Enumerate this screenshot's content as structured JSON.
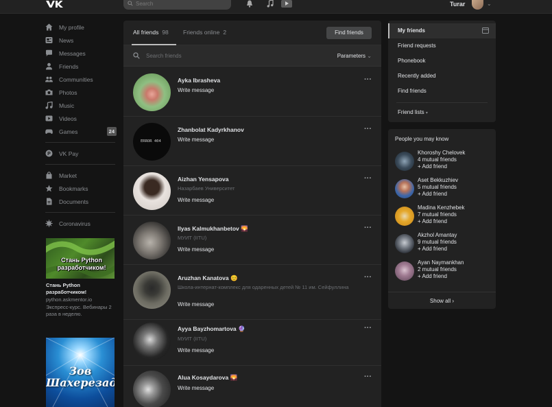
{
  "header": {
    "search_placeholder": "Search",
    "username": "Turar",
    "icons": [
      "vk-logo-icon",
      "search-icon",
      "bell-icon",
      "music-icon",
      "play-icon",
      "chevron-down-icon"
    ]
  },
  "sidebar": {
    "items": [
      {
        "label": "My profile",
        "icon": "home-icon"
      },
      {
        "label": "News",
        "icon": "news-icon"
      },
      {
        "label": "Messages",
        "icon": "messages-icon"
      },
      {
        "label": "Friends",
        "icon": "friends-icon"
      },
      {
        "label": "Communities",
        "icon": "communities-icon"
      },
      {
        "label": "Photos",
        "icon": "camera-icon"
      },
      {
        "label": "Music",
        "icon": "music-icon"
      },
      {
        "label": "Videos",
        "icon": "video-icon"
      },
      {
        "label": "Games",
        "icon": "gamepad-icon",
        "badge": "24"
      }
    ],
    "pay": {
      "label": "VK Pay"
    },
    "items2": [
      {
        "label": "Market"
      },
      {
        "label": "Bookmarks"
      },
      {
        "label": "Documents"
      }
    ],
    "corona": {
      "label": "Coronavirus"
    }
  },
  "ads": {
    "ad1_image_text": "Стань Python разработчиком!",
    "ad1_title": "Стань Python разработчиком!",
    "ad1_domain": "python.askmentor.io",
    "ad1_desc": "Экспресс-курс. Вебинары 2 раза в неделю.",
    "ad2_image_text": "Зов Шахерезады"
  },
  "main": {
    "tab_all_label": "All friends",
    "tab_all_count": "98",
    "tab_online_label": "Friends online",
    "tab_online_count": "2",
    "find_button": "Find friends",
    "search_placeholder": "Search friends",
    "parameters_label": "Parameters",
    "friends": [
      {
        "name": "Ayka Ibrasheva",
        "sub": "",
        "action": "Write message"
      },
      {
        "name": "Zhanbolat Kadyrkhanov",
        "sub": "",
        "action": "Write message",
        "avatar_text": "ERROR 404"
      },
      {
        "name": "Aizhan Yensapova",
        "sub": "Назарбаев Университет",
        "action": "Write message"
      },
      {
        "name": "Ilyas Kalmukhanbetov 🌄",
        "sub": "МУИТ (IITU)",
        "action": "Write message"
      },
      {
        "name": "Aruzhan Kanatova 😊",
        "sub": "Школа-интернат-комплекс для одаренных детей № 11 им. Сейфуллина",
        "action": "Write message"
      },
      {
        "name": "Ayya Bayzhomartova 🔮",
        "sub": "МУИТ (IITU)",
        "action": "Write message"
      },
      {
        "name": "Alua Kosaydarova 🌄",
        "sub": "",
        "action": "Write message"
      }
    ]
  },
  "right_menu": {
    "items": [
      "My friends",
      "Friend requests",
      "Phonebook",
      "Recently added",
      "Find friends"
    ],
    "friend_lists": "Friend lists"
  },
  "pymk": {
    "title": "People you may know",
    "people": [
      {
        "name": "Khoroshy Chelovek",
        "mutual": "4 mutual friends",
        "add": "+ Add friend"
      },
      {
        "name": "Aset Bekkuzhiev",
        "mutual": "5 mutual friends",
        "add": "+ Add friend"
      },
      {
        "name": "Madina Kenzhebek",
        "mutual": "7 mutual friends",
        "add": "+ Add friend"
      },
      {
        "name": "Akzhol Amantay",
        "mutual": "9 mutual friends",
        "add": "+ Add friend"
      },
      {
        "name": "Ayan Naymankhan",
        "mutual": "2 mutual friends",
        "add": "+ Add friend"
      }
    ],
    "show_all": "Show all"
  }
}
